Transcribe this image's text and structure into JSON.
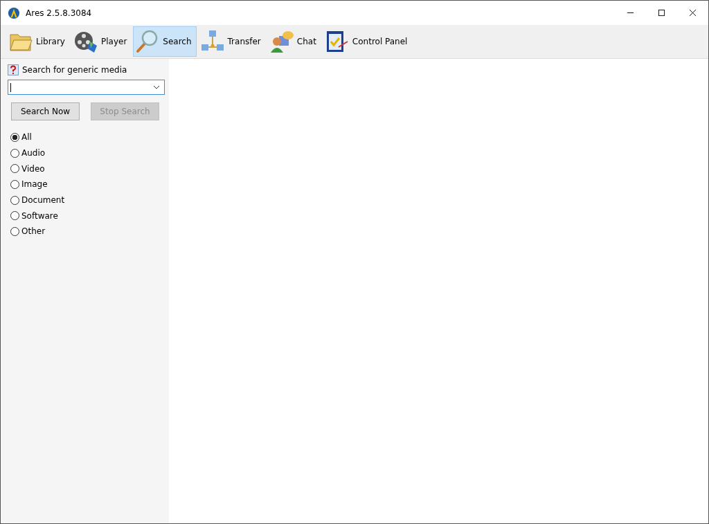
{
  "window": {
    "title": "Ares 2.5.8.3084"
  },
  "tabs": [
    {
      "label": "Library",
      "kind": "folder",
      "selected": false
    },
    {
      "label": "Player",
      "kind": "film",
      "selected": false
    },
    {
      "label": "Search",
      "kind": "magnifier",
      "selected": true
    },
    {
      "label": "Transfer",
      "kind": "network",
      "selected": false
    },
    {
      "label": "Chat",
      "kind": "chat",
      "selected": false
    },
    {
      "label": "Control Panel",
      "kind": "checklist",
      "selected": false
    }
  ],
  "search": {
    "heading": "Search for generic media",
    "buttons": [
      {
        "label": "Search Now",
        "disabled": false
      },
      {
        "label": "Stop Search",
        "disabled": true
      }
    ],
    "types": [
      {
        "label": "All",
        "selected": true
      },
      {
        "label": "Audio",
        "selected": false
      },
      {
        "label": "Video",
        "selected": false
      },
      {
        "label": "Image",
        "selected": false
      },
      {
        "label": "Document",
        "selected": false
      },
      {
        "label": "Software",
        "selected": false
      },
      {
        "label": "Other",
        "selected": false
      }
    ]
  }
}
